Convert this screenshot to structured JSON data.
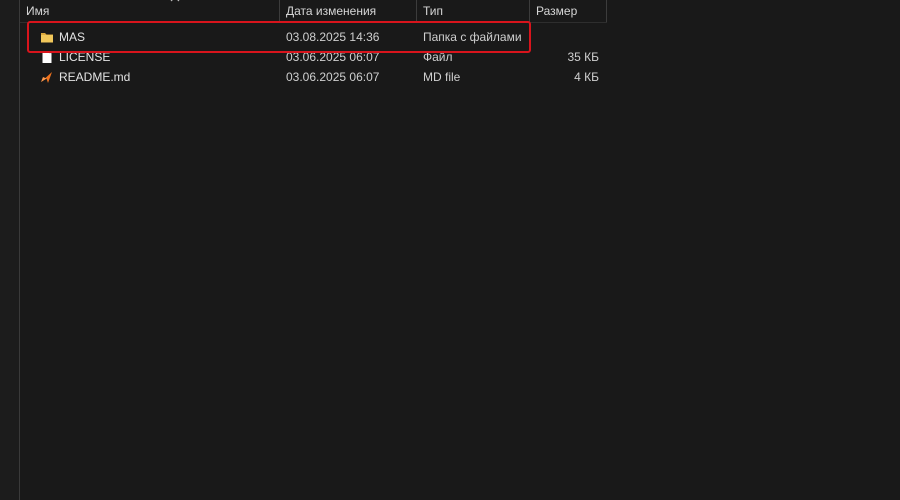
{
  "columns": {
    "name": "Имя",
    "date": "Дата изменения",
    "type": "Тип",
    "size": "Размер"
  },
  "files": [
    {
      "name": "MAS",
      "date": "03.08.2025 14:36",
      "type": "Папка с файлами",
      "size": "",
      "icon": "folder-icon",
      "color": "#f1c75b"
    },
    {
      "name": "LICENSE",
      "date": "03.06.2025 06:07",
      "type": "Файл",
      "size": "35 КБ",
      "icon": "blank-file-icon",
      "color": "#ffffff"
    },
    {
      "name": "README.md",
      "date": "03.06.2025 06:07",
      "type": "MD file",
      "size": "4 КБ",
      "icon": "markdown-file-icon",
      "color": "#f0731e"
    }
  ],
  "highlight_color": "#d8141c"
}
